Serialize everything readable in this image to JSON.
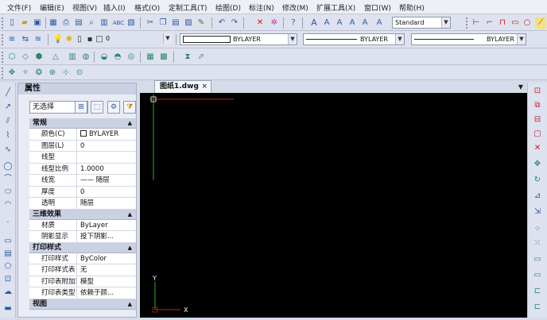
{
  "menu": [
    "文件(F)",
    "编辑(E)",
    "视图(V)",
    "插入(I)",
    "格式(O)",
    "定制工具(T)",
    "绘图(D)",
    "标注(N)",
    "修改(M)",
    "扩展工具(X)",
    "窗口(W)",
    "帮助(H)"
  ],
  "toolbar1": {
    "text_style": "Standard"
  },
  "toolbar2": {
    "layer": "0",
    "color": "BYLAYER",
    "linetype": "BYLAYER",
    "lineweight": "BYLAYER"
  },
  "panel": {
    "title": "属性",
    "selection": "无选择",
    "sections": [
      {
        "title": "常规",
        "rows": [
          {
            "k": "颜色(C)",
            "v": "BYLAYER"
          },
          {
            "k": "图层(L)",
            "v": "0"
          },
          {
            "k": "线型",
            "v": ""
          },
          {
            "k": "线型比例",
            "v": "1.0000"
          },
          {
            "k": "线宽",
            "v": "—— 随层"
          },
          {
            "k": "厚度",
            "v": "0"
          },
          {
            "k": "透明",
            "v": "随层"
          }
        ]
      },
      {
        "title": "三维效果",
        "rows": [
          {
            "k": "材质",
            "v": "ByLayer"
          },
          {
            "k": "阴影显示",
            "v": "投下阴影..."
          }
        ]
      },
      {
        "title": "打印样式",
        "rows": [
          {
            "k": "打印样式",
            "v": "ByColor"
          },
          {
            "k": "打印样式表",
            "v": "无"
          },
          {
            "k": "打印表附加到",
            "v": "模型"
          },
          {
            "k": "打印表类型",
            "v": "依赖于颜..."
          }
        ]
      },
      {
        "title": "视图",
        "rows": []
      }
    ]
  },
  "document": {
    "tab": "图纸1.dwg",
    "close": "×",
    "axis_x": "X",
    "axis_y": "Y"
  },
  "colors": {
    "canvas": "#000000",
    "crosshair_h": "#c02020",
    "crosshair_v": "#22b022"
  }
}
